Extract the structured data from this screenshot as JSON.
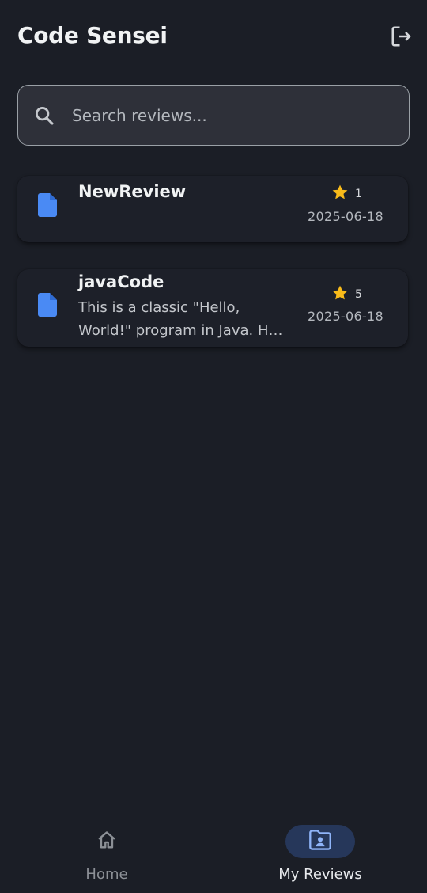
{
  "header": {
    "title": "Code Sensei",
    "logout_icon": "logout-icon"
  },
  "search": {
    "placeholder": "Search reviews...",
    "value": "",
    "icon": "search-icon"
  },
  "reviews": [
    {
      "title": "NewReview",
      "description": "",
      "rating": "1",
      "date": "2025-06-18",
      "icon": "file-icon"
    },
    {
      "title": "javaCode",
      "description": "This is a classic \"Hello, World!\" program in Java. H…",
      "rating": "5",
      "date": "2025-06-18",
      "icon": "file-icon"
    }
  ],
  "bottom_nav": {
    "items": [
      {
        "label": "Home",
        "icon": "home-icon",
        "active": false
      },
      {
        "label": "My Reviews",
        "icon": "folder-account-icon",
        "active": true
      }
    ]
  },
  "colors": {
    "background": "#1b1e26",
    "card": "#1d2029",
    "accent_blue": "#4a8af4",
    "star": "#f9bb1a",
    "active_pill": "#26375a"
  }
}
